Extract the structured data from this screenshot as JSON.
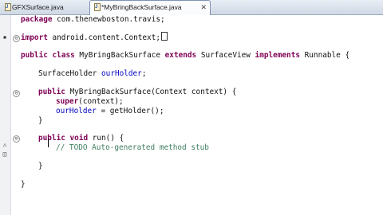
{
  "tabs": [
    {
      "label": "GFXSurface.java"
    },
    {
      "label": "*MyBringBackSurface.java",
      "close": "✕"
    }
  ],
  "code": {
    "line1": {
      "kw": "package",
      "rest": " com.thenewboston.travis;"
    },
    "line2": {
      "kw": "import",
      "rest": " android.content.Context;"
    },
    "line3": {
      "kw1": "public",
      "sp1": " ",
      "kw2": "class",
      "mid": " MyBringBackSurface ",
      "kw3": "extends",
      "mid2": " SurfaceView ",
      "kw4": "implements",
      "rest": " Runnable {"
    },
    "line4": {
      "type": "SurfaceHolder ",
      "field": "ourHolder",
      "rest": ";"
    },
    "line5": {
      "kw": "public",
      "rest": " MyBringBackSurface(Context context) {"
    },
    "line6": {
      "kw": "super",
      "rest": "(context);"
    },
    "line7": {
      "field": "ourHolder",
      "rest": " = getHolder();"
    },
    "line8": {
      "text": "}"
    },
    "line9": {
      "kw1": "public",
      "sp": " ",
      "kw2": "void",
      "rest": " run() {"
    },
    "line10": {
      "comment": "// TODO Auto-generated method stub"
    },
    "line11": {
      "text": "}"
    },
    "line12": {
      "text": "}"
    }
  }
}
